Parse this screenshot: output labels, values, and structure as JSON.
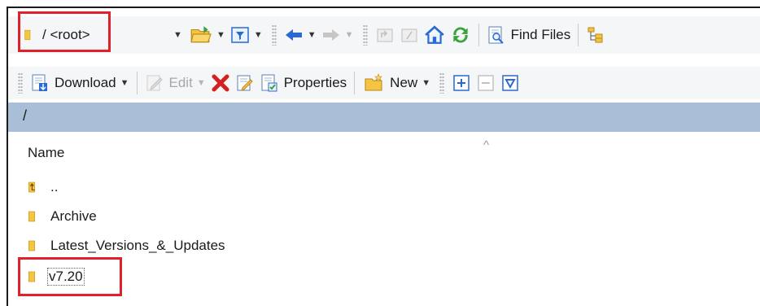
{
  "path_selector": {
    "value": "/ <root>"
  },
  "toolbar1": {
    "find_files_label": "Find Files"
  },
  "toolbar2": {
    "download_label": "Download",
    "edit_label": "Edit",
    "properties_label": "Properties",
    "new_label": "New"
  },
  "path_bar": {
    "text": "/"
  },
  "list": {
    "column_name": "Name",
    "sort_indicator": "^",
    "items": [
      {
        "label": "..",
        "icon": "parent-folder-icon"
      },
      {
        "label": "Archive",
        "icon": "folder-icon"
      },
      {
        "label": "Latest_Versions_&_Updates",
        "icon": "folder-icon"
      },
      {
        "label": "v7.20",
        "icon": "folder-icon"
      }
    ]
  },
  "colors": {
    "highlight": "#e0202a",
    "path_bar_bg": "#a9bfd8",
    "folder": "#f4c542",
    "delete_red": "#d42020",
    "refresh_green": "#3aa33a",
    "arrow_blue": "#2a6ad0"
  }
}
